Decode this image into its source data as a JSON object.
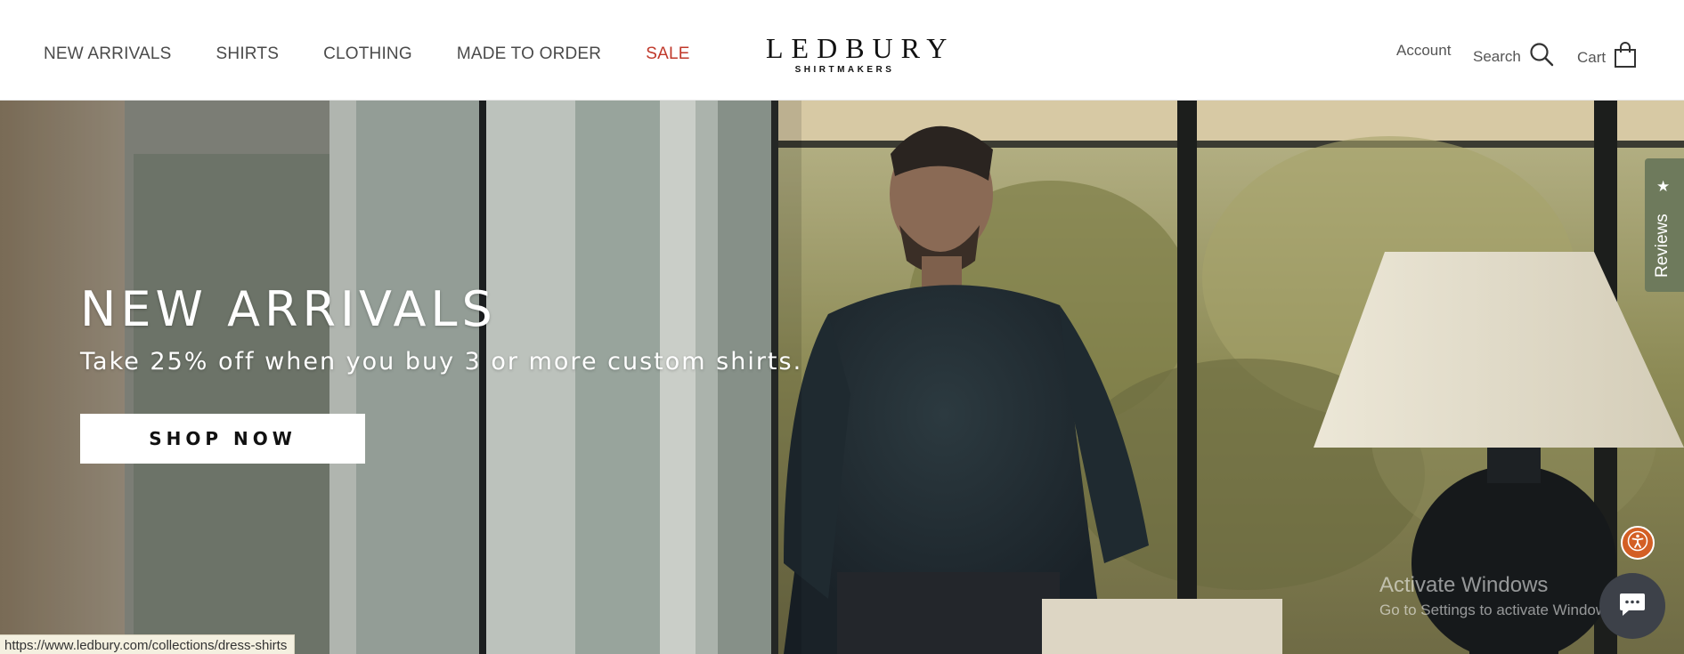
{
  "header": {
    "nav": [
      {
        "label": "NEW ARRIVALS"
      },
      {
        "label": "SHIRTS"
      },
      {
        "label": "CLOTHING"
      },
      {
        "label": "MADE TO ORDER"
      },
      {
        "label": "SALE"
      }
    ],
    "logo": {
      "main": "LEDBURY",
      "sub": "SHIRTMAKERS"
    },
    "account_label": "Account",
    "search_label": "Search",
    "cart_label": "Cart",
    "icons": {
      "search": "search-icon",
      "cart": "shopping-bag-icon"
    }
  },
  "hero": {
    "title": "NEW ARRIVALS",
    "subtitle": "Take 25% off when you buy 3 or more custom shirts.",
    "cta_label": "SHOP NOW"
  },
  "reviews_tab": {
    "label": "Reviews",
    "icon": "star-icon"
  },
  "watermark": {
    "title": "Activate Windows",
    "subtitle": "Go to Settings to activate Windows."
  },
  "status_bar": {
    "url": "https://www.ledbury.com/collections/dress-shirts"
  },
  "colors": {
    "sale": "#c0392b",
    "reviews_tab": "#6e7a5c",
    "accessibility": "#d35f25",
    "chat": "#3d4149"
  }
}
